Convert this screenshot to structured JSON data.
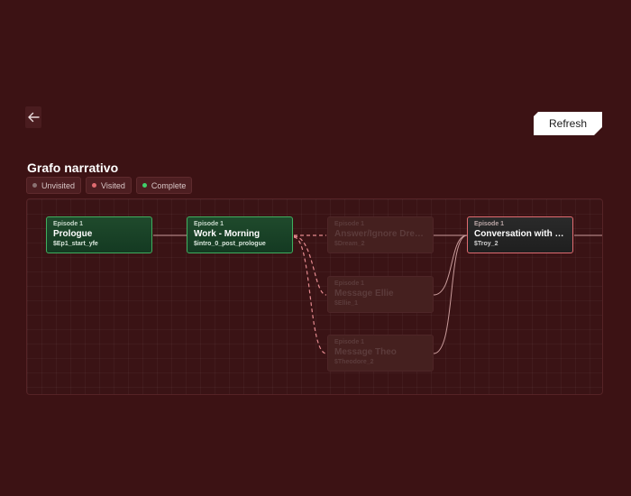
{
  "header": {
    "refresh_label": "Refresh"
  },
  "page_title": "Grafo narrativo",
  "legend": [
    {
      "label": "Unvisited",
      "color": "#8a7272"
    },
    {
      "label": "Visited",
      "color": "#e06b70"
    },
    {
      "label": "Complete",
      "color": "#3fd06a"
    }
  ],
  "nodes": [
    {
      "episode": "Episode 1",
      "name": "Prologue",
      "id": "$Ep1_start_yfe",
      "status": "complete"
    },
    {
      "episode": "Episode 1",
      "name": "Work - Morning",
      "id": "$intro_0_post_prologue",
      "status": "complete"
    },
    {
      "episode": "Episode 1",
      "name": "Answer/Ignore Dream",
      "id": "$Dream_2",
      "status": "unvisited"
    },
    {
      "episode": "Episode 1",
      "name": "Message Ellie",
      "id": "$Ellie_1",
      "status": "unvisited"
    },
    {
      "episode": "Episode 1",
      "name": "Message Theo",
      "id": "$Theodore_2",
      "status": "unvisited"
    },
    {
      "episode": "Episode 1",
      "name": "Conversation with T...",
      "id": "$Troy_2",
      "status": "visited"
    }
  ],
  "colors": {
    "background": "#3c1214",
    "complete": "#3fae5e",
    "visited": "#e06b70",
    "edge_dashed": "#e58a8f",
    "edge_solid": "#c99b9b"
  }
}
